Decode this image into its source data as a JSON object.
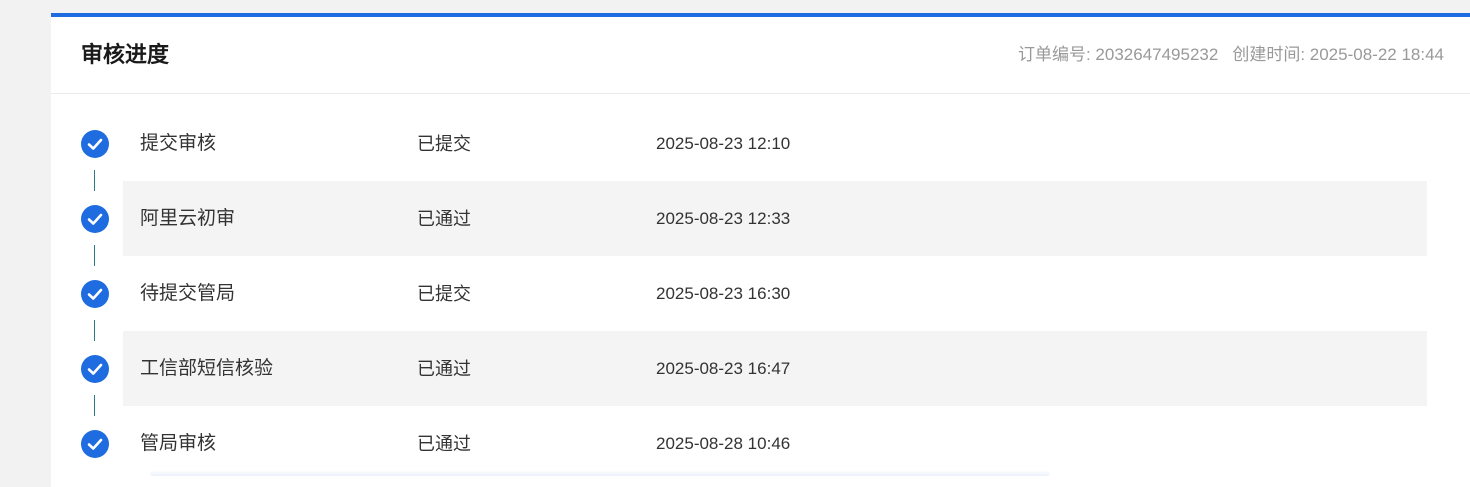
{
  "header": {
    "title": "审核进度",
    "order_label": "订单编号: 2032647495232",
    "created_label": "创建时间: 2025-08-22 18:44"
  },
  "colors": {
    "accent": "#1e6ce0",
    "connector": "#2c7a87",
    "alt_row": "#f4f4f4"
  },
  "steps": [
    {
      "name": "提交审核",
      "status": "已提交",
      "time": "2025-08-23 12:10",
      "icon": "check-circle-icon"
    },
    {
      "name": "阿里云初审",
      "status": "已通过",
      "time": "2025-08-23 12:33",
      "icon": "check-circle-icon"
    },
    {
      "name": "待提交管局",
      "status": "已提交",
      "time": "2025-08-23 16:30",
      "icon": "check-circle-icon"
    },
    {
      "name": "工信部短信核验",
      "status": "已通过",
      "time": "2025-08-23 16:47",
      "icon": "check-circle-icon"
    },
    {
      "name": "管局审核",
      "status": "已通过",
      "time": "2025-08-28 10:46",
      "icon": "check-circle-icon"
    }
  ]
}
